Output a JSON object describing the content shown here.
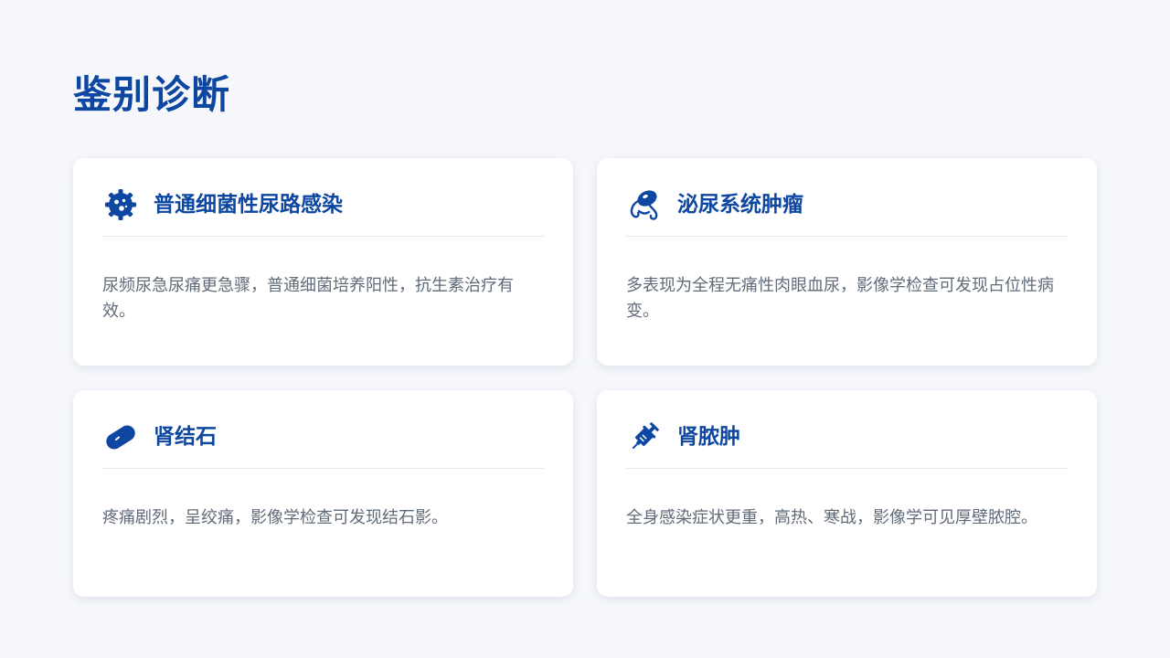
{
  "page": {
    "title": "鉴别诊断"
  },
  "colors": {
    "accent": "#0d47a1",
    "text_secondary": "#606b79",
    "background": "#f5f7fb",
    "card": "#ffffff"
  },
  "cards": [
    {
      "icon": "bacteria-icon",
      "title": "普通细菌性尿路感染",
      "description": "尿频尿急尿痛更急骤，普通细菌培养阳性，抗生素治疗有效。"
    },
    {
      "icon": "organ-tumor-icon",
      "title": "泌尿系统肿瘤",
      "description": "多表现为全程无痛性肉眼血尿，影像学检查可发现占位性病变。"
    },
    {
      "icon": "capsule-icon",
      "title": "肾结石",
      "description": "疼痛剧烈，呈绞痛，影像学检查可发现结石影。"
    },
    {
      "icon": "syringe-icon",
      "title": "肾脓肿",
      "description": "全身感染症状更重，高热、寒战，影像学可见厚壁脓腔。"
    }
  ]
}
